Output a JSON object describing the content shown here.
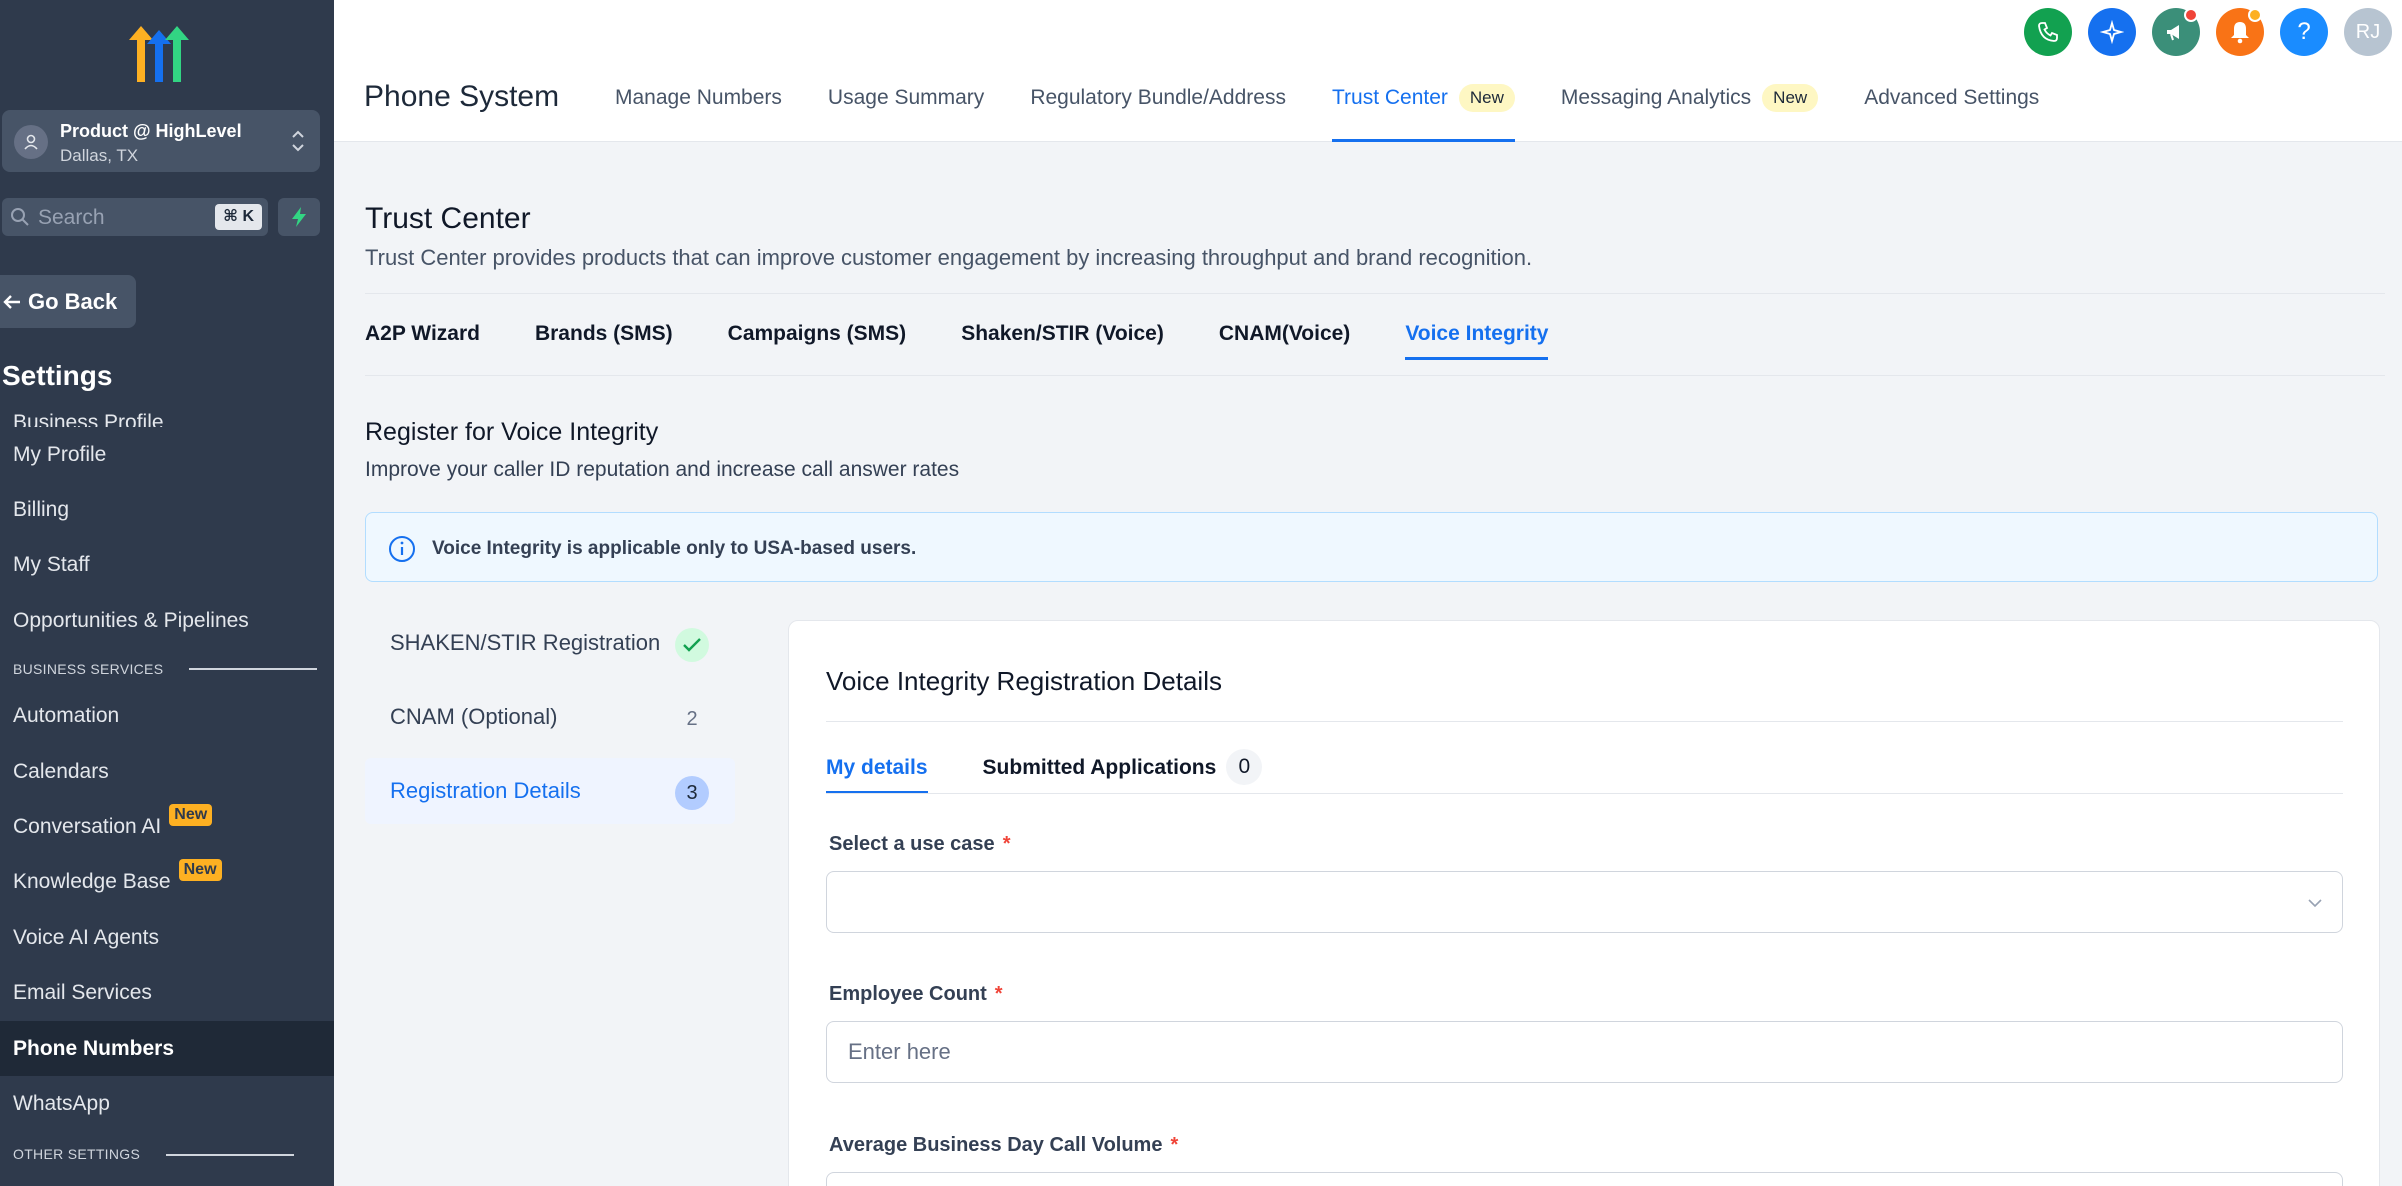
{
  "sidebar": {
    "location_name": "Product @ HighLevel",
    "location_city": "Dallas, TX",
    "search_placeholder": "Search",
    "search_shortcut": "⌘ K",
    "go_back": "Go Back",
    "settings_title": "Settings",
    "items": [
      {
        "label": "Business Profile"
      },
      {
        "label": "My Profile"
      },
      {
        "label": "Billing"
      },
      {
        "label": "My Staff"
      },
      {
        "label": "Opportunities & Pipelines"
      }
    ],
    "section_business": "BUSINESS SERVICES",
    "business_items": [
      {
        "label": "Automation"
      },
      {
        "label": "Calendars"
      },
      {
        "label": "Conversation AI",
        "badge": "New"
      },
      {
        "label": "Knowledge Base",
        "badge": "New"
      },
      {
        "label": "Voice AI Agents"
      },
      {
        "label": "Email Services"
      },
      {
        "label": "Phone Numbers",
        "active": true
      },
      {
        "label": "WhatsApp"
      }
    ],
    "section_other": "OTHER SETTINGS"
  },
  "topbar": {
    "icons": [
      "phone-icon",
      "sparkle-icon",
      "megaphone-icon",
      "bell-icon",
      "help-icon"
    ],
    "avatar_initials": "RJ",
    "help_glyph": "?"
  },
  "subnav": {
    "title": "Phone System",
    "tabs": [
      {
        "label": "Manage Numbers"
      },
      {
        "label": "Usage Summary"
      },
      {
        "label": "Regulatory Bundle/Address"
      },
      {
        "label": "Trust Center",
        "badge": "New",
        "active": true
      },
      {
        "label": "Messaging Analytics",
        "badge": "New"
      },
      {
        "label": "Advanced Settings"
      }
    ]
  },
  "trust_center": {
    "title": "Trust Center",
    "description": "Trust Center provides products that can improve customer engagement by increasing throughput and brand recognition.",
    "tabs": [
      {
        "label": "A2P Wizard"
      },
      {
        "label": "Brands (SMS)"
      },
      {
        "label": "Campaigns (SMS)"
      },
      {
        "label": "Shaken/STIR (Voice)"
      },
      {
        "label": "CNAM(Voice)"
      },
      {
        "label": "Voice Integrity",
        "active": true
      }
    ]
  },
  "voice_integrity": {
    "title": "Register for Voice Integrity",
    "subtitle": "Improve your caller ID reputation and increase call answer rates",
    "info": "Voice Integrity is applicable only to USA-based users.",
    "steps": [
      {
        "label": "SHAKEN/STIR Registration",
        "status": "done"
      },
      {
        "label": "CNAM (Optional)",
        "number": "2"
      },
      {
        "label": "Registration Details",
        "number": "3",
        "active": true
      }
    ],
    "card": {
      "title": "Voice Integrity Registration Details",
      "tab_my_details": "My details",
      "tab_submitted": "Submitted Applications",
      "submitted_count": "0",
      "use_case_label": "Select a use case",
      "use_case_value": "",
      "employee_label": "Employee Count",
      "employee_placeholder": "Enter here",
      "call_volume_label": "Average Business Day Call Volume",
      "required_mark": "*"
    }
  },
  "colors": {
    "sidebar_bg": "#2f3a4c",
    "accent": "#1570ef",
    "phone_btn": "#12a150",
    "sparkle_btn": "#1570ef",
    "megaphone_btn": "#3b8f79",
    "bell_btn": "#f97316",
    "help_btn": "#1a8cff"
  }
}
